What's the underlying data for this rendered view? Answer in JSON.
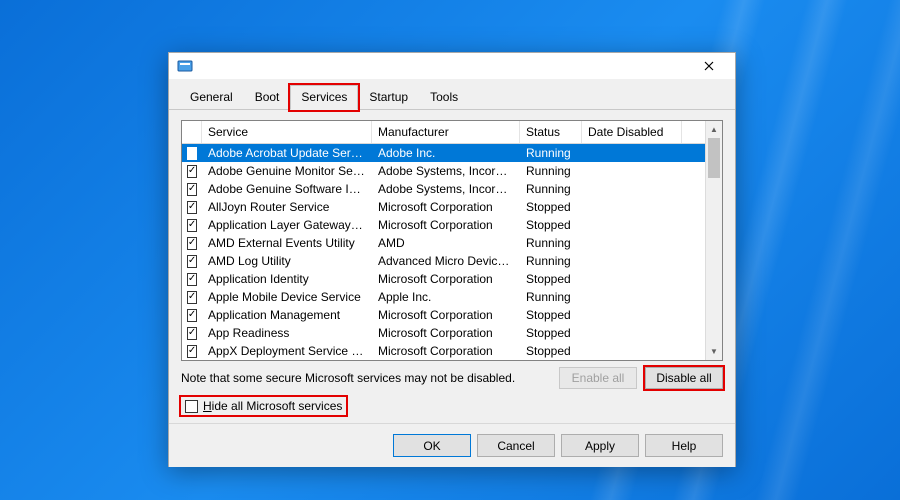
{
  "window": {
    "title": ""
  },
  "tabs": {
    "general": "General",
    "boot": "Boot",
    "services": "Services",
    "startup": "Startup",
    "tools": "Tools"
  },
  "columns": {
    "service": "Service",
    "manufacturer": "Manufacturer",
    "status": "Status",
    "date_disabled": "Date Disabled"
  },
  "rows": [
    {
      "checked": true,
      "selected": true,
      "service": "Adobe Acrobat Update Service",
      "manufacturer": "Adobe Inc.",
      "status": "Running",
      "date_disabled": ""
    },
    {
      "checked": true,
      "selected": false,
      "service": "Adobe Genuine Monitor Service",
      "manufacturer": "Adobe Systems, Incorpora...",
      "status": "Running",
      "date_disabled": ""
    },
    {
      "checked": true,
      "selected": false,
      "service": "Adobe Genuine Software Integri...",
      "manufacturer": "Adobe Systems, Incorpora...",
      "status": "Running",
      "date_disabled": ""
    },
    {
      "checked": true,
      "selected": false,
      "service": "AllJoyn Router Service",
      "manufacturer": "Microsoft Corporation",
      "status": "Stopped",
      "date_disabled": ""
    },
    {
      "checked": true,
      "selected": false,
      "service": "Application Layer Gateway Service",
      "manufacturer": "Microsoft Corporation",
      "status": "Stopped",
      "date_disabled": ""
    },
    {
      "checked": true,
      "selected": false,
      "service": "AMD External Events Utility",
      "manufacturer": "AMD",
      "status": "Running",
      "date_disabled": ""
    },
    {
      "checked": true,
      "selected": false,
      "service": "AMD Log Utility",
      "manufacturer": "Advanced Micro Devices, I...",
      "status": "Running",
      "date_disabled": ""
    },
    {
      "checked": true,
      "selected": false,
      "service": "Application Identity",
      "manufacturer": "Microsoft Corporation",
      "status": "Stopped",
      "date_disabled": ""
    },
    {
      "checked": true,
      "selected": false,
      "service": "Apple Mobile Device Service",
      "manufacturer": "Apple Inc.",
      "status": "Running",
      "date_disabled": ""
    },
    {
      "checked": true,
      "selected": false,
      "service": "Application Management",
      "manufacturer": "Microsoft Corporation",
      "status": "Stopped",
      "date_disabled": ""
    },
    {
      "checked": true,
      "selected": false,
      "service": "App Readiness",
      "manufacturer": "Microsoft Corporation",
      "status": "Stopped",
      "date_disabled": ""
    },
    {
      "checked": true,
      "selected": false,
      "service": "AppX Deployment Service (AppX...",
      "manufacturer": "Microsoft Corporation",
      "status": "Stopped",
      "date_disabled": ""
    }
  ],
  "note": "Note that some secure Microsoft services may not be disabled.",
  "buttons": {
    "enable_all": "Enable all",
    "disable_all": "Disable all",
    "ok": "OK",
    "cancel": "Cancel",
    "apply": "Apply",
    "help": "Help"
  },
  "hide_checkbox": {
    "label": "Hide all Microsoft services",
    "checked": false
  }
}
